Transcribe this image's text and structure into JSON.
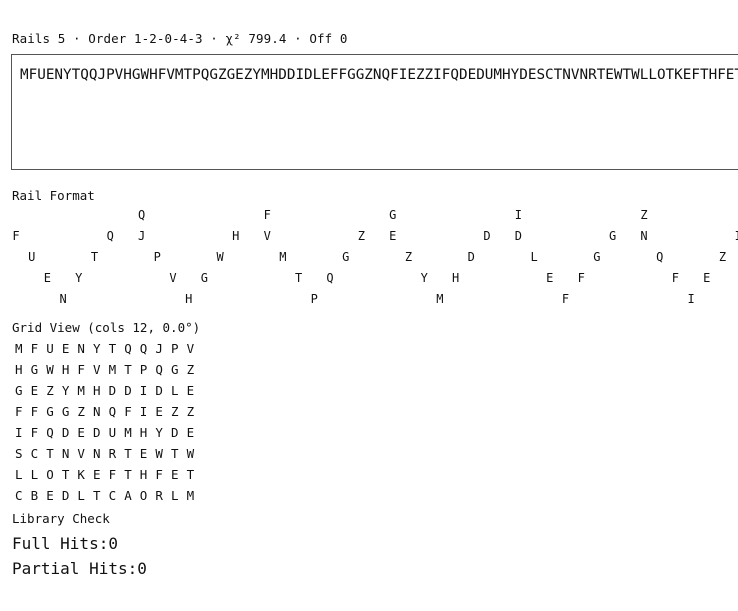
{
  "header": {
    "status_line": "Rails 5 · Order 1-2-0-4-3 · χ² 799.4 · Off 0"
  },
  "cipher": {
    "text": "MFUENYTQQJPVHGWHFVMTPQGZGEZYMHDDIDLEFFGGZNQFIEZZIFQDEDUMHYDESCTNVNRTEWTWLLOTKEFTHFETCBEDLTCAORLM"
  },
  "rail_format": {
    "label": "Rail Format",
    "rows": [
      [
        "Q",
        "F",
        "G",
        "I",
        "Z"
      ],
      [
        "F",
        "Q",
        "J",
        "H",
        "V",
        "Z",
        "E",
        "D",
        "D",
        "G",
        "N",
        "I"
      ],
      [
        "U",
        "T",
        "P",
        "W",
        "M",
        "G",
        "Z",
        "D",
        "L",
        "G",
        "Q",
        "Z"
      ],
      [
        "E",
        "Y",
        "V",
        "G",
        "T",
        "Q",
        "Y",
        "H",
        "E",
        "F",
        "F",
        "E"
      ],
      [
        "N",
        "H",
        "P",
        "M",
        "F",
        "I"
      ]
    ]
  },
  "grid_view": {
    "label": "Grid View (cols 12, 0.0°)",
    "rows": [
      [
        "M",
        "F",
        "U",
        "E",
        "N",
        "Y",
        "T",
        "Q",
        "Q",
        "J",
        "P",
        "V"
      ],
      [
        "H",
        "G",
        "W",
        "H",
        "F",
        "V",
        "M",
        "T",
        "P",
        "Q",
        "G",
        "Z"
      ],
      [
        "G",
        "E",
        "Z",
        "Y",
        "M",
        "H",
        "D",
        "D",
        "I",
        "D",
        "L",
        "E"
      ],
      [
        "F",
        "F",
        "G",
        "G",
        "Z",
        "N",
        "Q",
        "F",
        "I",
        "E",
        "Z",
        "Z"
      ],
      [
        "I",
        "F",
        "Q",
        "D",
        "E",
        "D",
        "U",
        "M",
        "H",
        "Y",
        "D",
        "E"
      ],
      [
        "S",
        "C",
        "T",
        "N",
        "V",
        "N",
        "R",
        "T",
        "E",
        "W",
        "T",
        "W"
      ],
      [
        "L",
        "L",
        "O",
        "T",
        "K",
        "E",
        "F",
        "T",
        "H",
        "F",
        "E",
        "T"
      ],
      [
        "C",
        "B",
        "E",
        "D",
        "L",
        "T",
        "C",
        "A",
        "O",
        "R",
        "L",
        "M"
      ]
    ]
  },
  "library_check": {
    "label": "Library Check",
    "full_hits_label": "Full Hits:",
    "full_hits_value": "0",
    "partial_hits_label": "Partial Hits:",
    "partial_hits_value": "0"
  }
}
